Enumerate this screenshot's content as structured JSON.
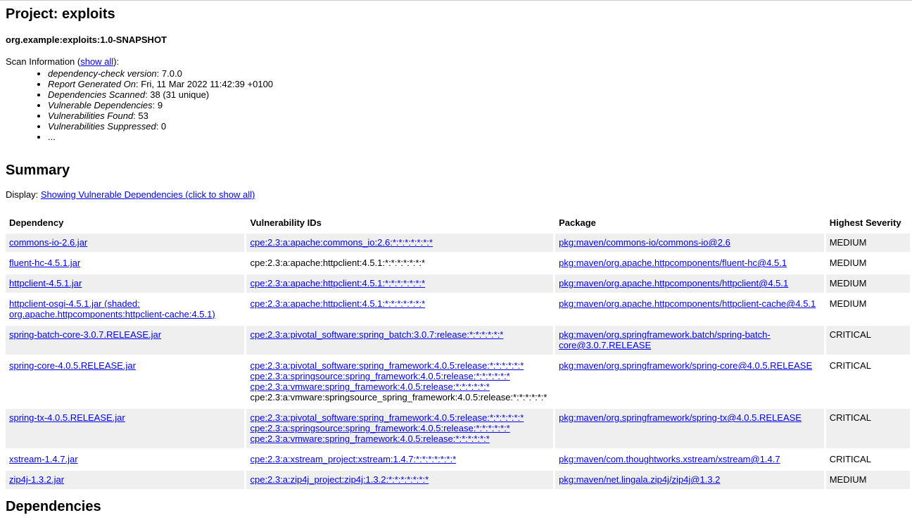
{
  "project": {
    "title": "Project: exploits",
    "coordinates": "org.example:exploits:1.0-SNAPSHOT"
  },
  "scan": {
    "label": "Scan Information (",
    "show_all": "show all",
    "label_end": "):",
    "items": [
      {
        "key": "dependency-check version",
        "value": ": 7.0.0"
      },
      {
        "key": "Report Generated On",
        "value": ": Fri, 11 Mar 2022 11:42:39 +0100"
      },
      {
        "key": "Dependencies Scanned",
        "value": ": 38 (31 unique)"
      },
      {
        "key": "Vulnerable Dependencies",
        "value": ": 9"
      },
      {
        "key": "Vulnerabilities Found",
        "value": ": 53"
      },
      {
        "key": "Vulnerabilities Suppressed",
        "value": ": 0"
      },
      {
        "key": "",
        "value": "..."
      }
    ]
  },
  "summary": {
    "heading": "Summary",
    "display_label": "Display: ",
    "display_link": "Showing Vulnerable Dependencies (click to show all)",
    "columns": [
      "Dependency",
      "Vulnerability IDs",
      "Package",
      "Highest Severity"
    ],
    "rows": [
      {
        "dependency": "commons-io-2.6.jar",
        "vuln_ids": [
          {
            "text": "cpe:2.3:a:apache:commons_io:2.6:*:*:*:*:*:*:*",
            "link": true
          }
        ],
        "package": "pkg:maven/commons-io/commons-io@2.6",
        "severity": "MEDIUM"
      },
      {
        "dependency": "fluent-hc-4.5.1.jar",
        "vuln_ids": [
          {
            "text": "cpe:2.3:a:apache:httpclient:4.5.1:*:*:*:*:*:*:*",
            "link": false
          }
        ],
        "package": "pkg:maven/org.apache.httpcomponents/fluent-hc@4.5.1",
        "severity": "MEDIUM"
      },
      {
        "dependency": "httpclient-4.5.1.jar",
        "vuln_ids": [
          {
            "text": "cpe:2.3:a:apache:httpclient:4.5.1:*:*:*:*:*:*:*",
            "link": true
          }
        ],
        "package": "pkg:maven/org.apache.httpcomponents/httpclient@4.5.1",
        "severity": "MEDIUM"
      },
      {
        "dependency": "httpclient-osgi-4.5.1.jar (shaded: org.apache.httpcomponents:httpclient-cache:4.5.1)",
        "vuln_ids": [
          {
            "text": "cpe:2.3:a:apache:httpclient:4.5.1:*:*:*:*:*:*:*",
            "link": true
          }
        ],
        "package": "pkg:maven/org.apache.httpcomponents/httpclient-cache@4.5.1",
        "severity": "MEDIUM"
      },
      {
        "dependency": "spring-batch-core-3.0.7.RELEASE.jar",
        "vuln_ids": [
          {
            "text": "cpe:2.3:a:pivotal_software:spring_batch:3.0.7:release:*:*:*:*:*:*",
            "link": true
          }
        ],
        "package": "pkg:maven/org.springframework.batch/spring-batch-core@3.0.7.RELEASE",
        "severity": "CRITICAL"
      },
      {
        "dependency": "spring-core-4.0.5.RELEASE.jar",
        "vuln_ids": [
          {
            "text": "cpe:2.3:a:pivotal_software:spring_framework:4.0.5:release:*:*:*:*:*:*",
            "link": true
          },
          {
            "text": "cpe:2.3:a:springsource:spring_framework:4.0.5:release:*:*:*:*:*:*",
            "link": true
          },
          {
            "text": "cpe:2.3:a:vmware:spring_framework:4.0.5:release:*:*:*:*:*:*",
            "link": true
          },
          {
            "text": "cpe:2.3:a:vmware:springsource_spring_framework:4.0.5:release:*:*:*:*:*:*",
            "link": false
          }
        ],
        "package": "pkg:maven/org.springframework/spring-core@4.0.5.RELEASE",
        "severity": "CRITICAL"
      },
      {
        "dependency": "spring-tx-4.0.5.RELEASE.jar",
        "vuln_ids": [
          {
            "text": "cpe:2.3:a:pivotal_software:spring_framework:4.0.5:release:*:*:*:*:*:*",
            "link": true
          },
          {
            "text": "cpe:2.3:a:springsource:spring_framework:4.0.5:release:*:*:*:*:*:*",
            "link": true
          },
          {
            "text": "cpe:2.3:a:vmware:spring_framework:4.0.5:release:*:*:*:*:*:*",
            "link": true
          }
        ],
        "package": "pkg:maven/org.springframework/spring-tx@4.0.5.RELEASE",
        "severity": "CRITICAL"
      },
      {
        "dependency": "xstream-1.4.7.jar",
        "vuln_ids": [
          {
            "text": "cpe:2.3:a:xstream_project:xstream:1.4.7:*:*:*:*:*:*:*",
            "link": true
          }
        ],
        "package": "pkg:maven/com.thoughtworks.xstream/xstream@1.4.7",
        "severity": "CRITICAL"
      },
      {
        "dependency": "zip4j-1.3.2.jar",
        "vuln_ids": [
          {
            "text": "cpe:2.3:a:zip4j_project:zip4j:1.3.2:*:*:*:*:*:*:*",
            "link": true
          }
        ],
        "package": "pkg:maven/net.lingala.zip4j/zip4j@1.3.2",
        "severity": "MEDIUM"
      }
    ]
  },
  "dependencies_heading": "Dependencies"
}
